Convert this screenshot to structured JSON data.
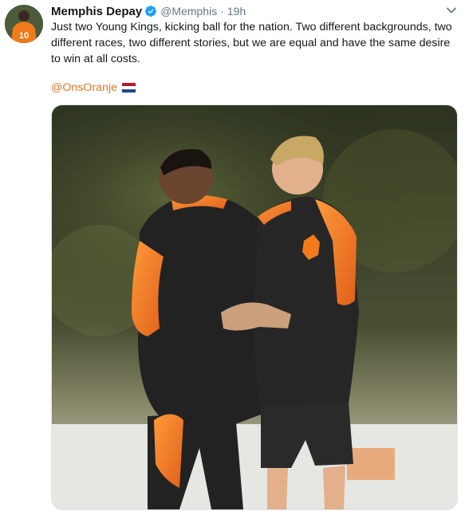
{
  "tweet": {
    "author_name": "Memphis Depay",
    "author_handle": "@Memphis",
    "separator": "·",
    "timestamp": "19h",
    "body_text": "Just two Young Kings, kicking ball for the nation. Two different backgrounds, two different races, two different stories, but we are equal and have the same desire to win at all costs.",
    "mention": "@OnsOranje",
    "flag_icon": "netherlands-flag-icon",
    "verified_icon": "verified-badge-icon",
    "menu_icon": "chevron-down-icon",
    "avatar_number": "10"
  },
  "colors": {
    "mention": "#e0772a",
    "verified": "#1da1f2",
    "kit_orange": "#f27a1a",
    "kit_black": "#222222",
    "flag": [
      "#ae1c28",
      "#ffffff",
      "#21468b"
    ]
  }
}
